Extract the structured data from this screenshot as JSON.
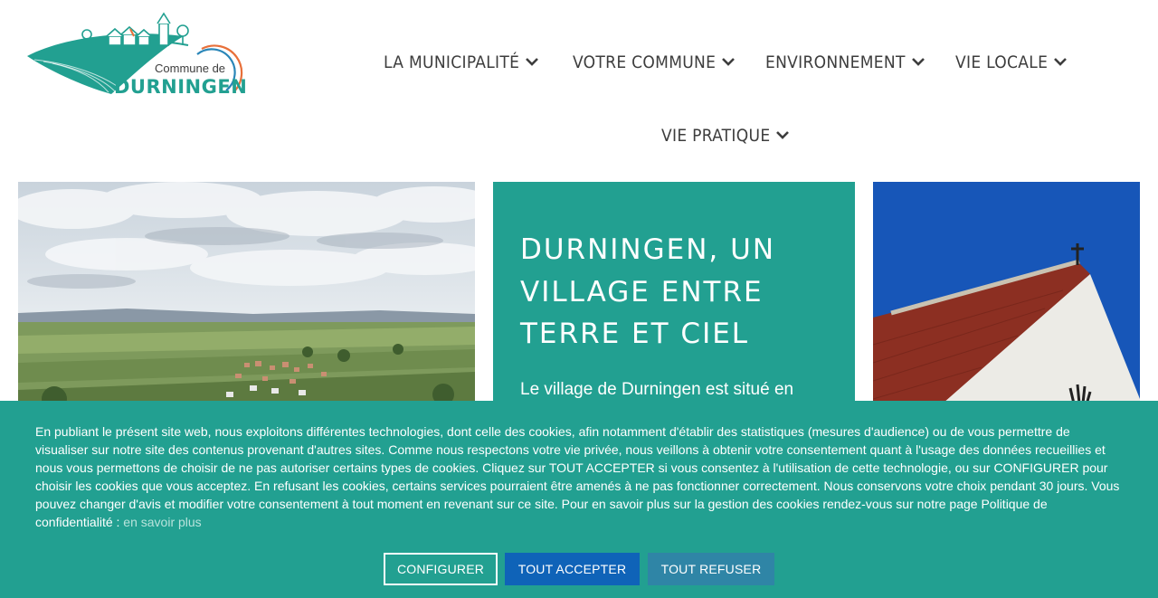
{
  "logo": {
    "line1": "Commune de",
    "line2": "DURNINGEN",
    "colors": {
      "teal": "#22a091",
      "orange": "#e8703a",
      "blue": "#2a86b8"
    }
  },
  "nav": {
    "items": [
      {
        "label": "LA MUNICIPALITÉ",
        "icon": "chevron-down-icon"
      },
      {
        "label": "VOTRE COMMUNE",
        "icon": "chevron-down-icon"
      },
      {
        "label": "ENVIRONNEMENT",
        "icon": "chevron-down-icon"
      },
      {
        "label": "VIE LOCALE",
        "icon": "chevron-down-icon"
      },
      {
        "label": "VIE PRATIQUE",
        "icon": "chevron-down-icon"
      }
    ]
  },
  "feature": {
    "title": "DURNINGEN, UN VILLAGE ENTRE TERRE ET CIEL",
    "text": "Le village de Durningen est situé en",
    "bg": "#22a091"
  },
  "cookie_banner": {
    "text": "En publiant le présent site web, nous exploitons différentes technologies, dont celle des cookies, afin notamment d'établir des statistiques (mesures d'audience) ou de vous permettre de visualiser sur notre site des contenus provenant d'autres sites. Comme nous respectons votre vie privée, nous veillons à obtenir votre consentement quant à l'usage des données recueillies et nous vous permettons de choisir de ne pas autoriser certains types de cookies. Cliquez sur TOUT ACCEPTER si vous consentez à l'utilisation de cette technologie, ou sur CONFIGURER pour choisir les cookies que vous acceptez. En refusant les cookies, certains services pourraient être amenés à ne pas fonctionner correctement. Nous conservons votre choix pendant 30 jours. Vous pouvez changer d'avis et modifier votre consentement à tout moment en revenant sur ce site. Pour en savoir plus sur la gestion des cookies rendez-vous sur notre page Politique de confidentialité :",
    "more_link": "en savoir plus",
    "configure_label": "CONFIGURER",
    "accept_label": "TOUT ACCEPTER",
    "refuse_label": "TOUT REFUSER",
    "colors": {
      "banner": "#22a091",
      "accept": "#0f63b8",
      "refuse": "#2f85a6"
    }
  }
}
